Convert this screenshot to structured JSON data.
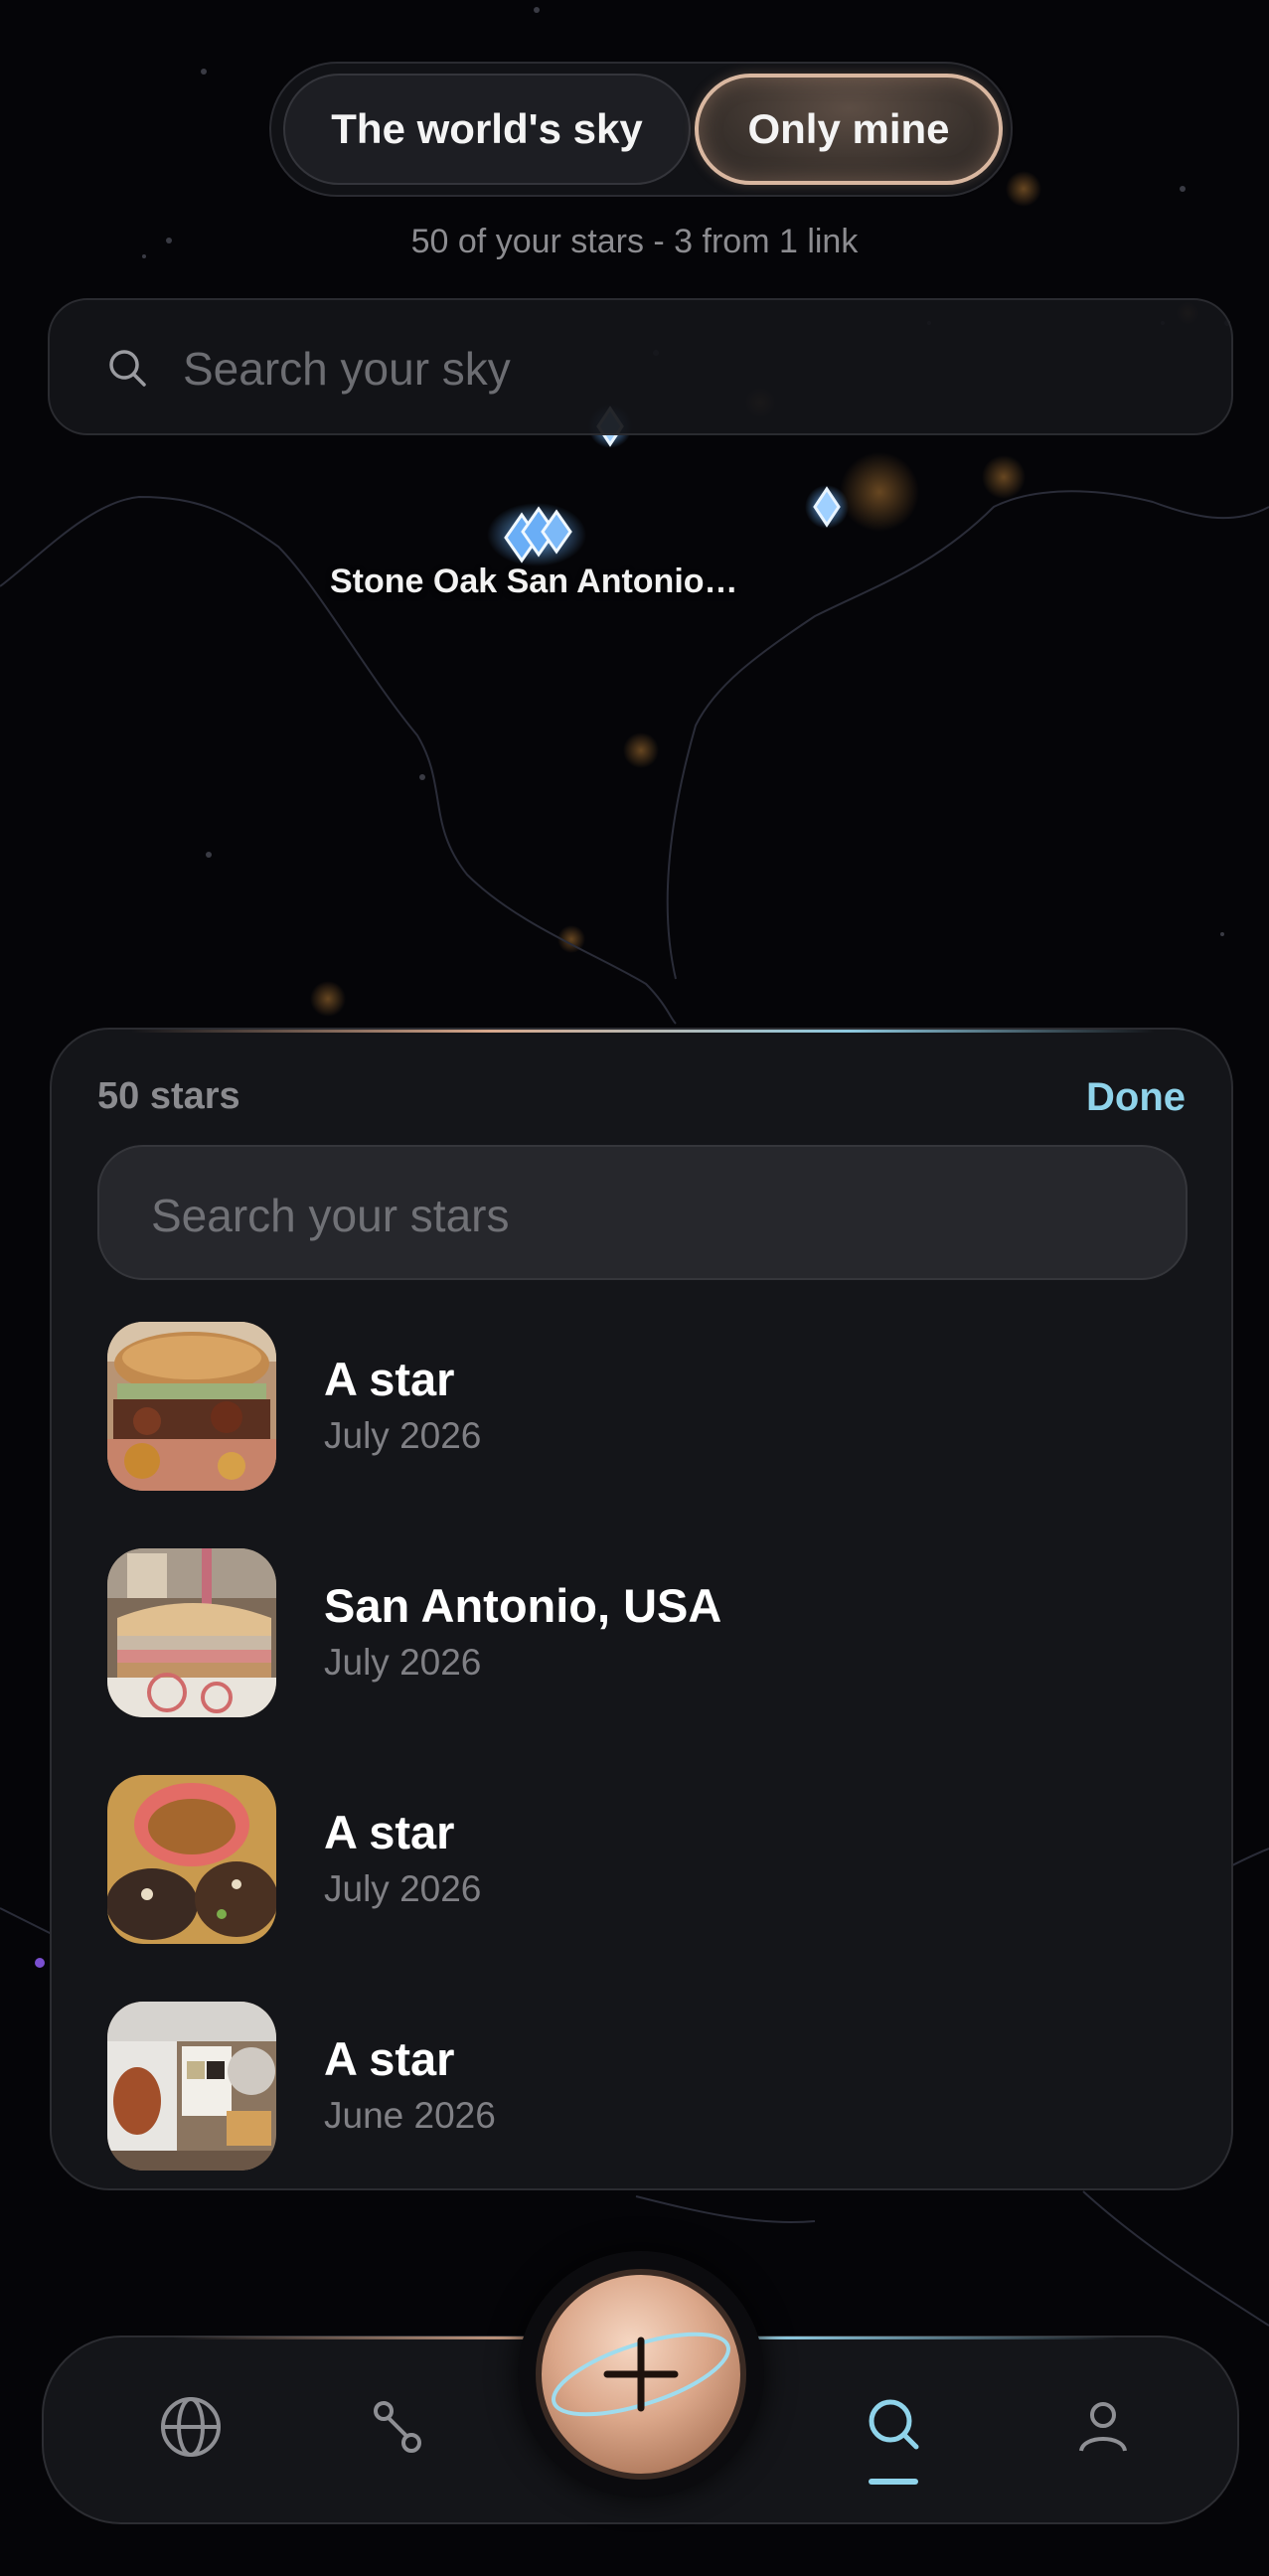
{
  "toggle": {
    "world_label": "The world's sky",
    "mine_label": "Only mine",
    "selected": "Only mine"
  },
  "subtitle": "50 of your stars - 3 from 1 link",
  "sky_search": {
    "placeholder": "Search your sky"
  },
  "map": {
    "cluster_label": "Stone Oak San Antonio…"
  },
  "panel": {
    "count": "50 stars",
    "done_label": "Done",
    "search_placeholder": "Search your stars",
    "items": [
      {
        "title": "A star",
        "date": "July 2026",
        "image": "burger-photo"
      },
      {
        "title": "San Antonio, USA",
        "date": "July 2026",
        "image": "sandwich-photo"
      },
      {
        "title": "A star",
        "date": "July 2026",
        "image": "tacos-photo"
      },
      {
        "title": "A star",
        "date": "June 2026",
        "image": "plate-photo"
      }
    ]
  },
  "nav": {
    "items": [
      "globe-icon",
      "route-icon",
      "search-icon",
      "profile-icon"
    ],
    "active": "search-icon",
    "fab_icon": "plus-icon"
  },
  "colors": {
    "accent": "#8fd3ea",
    "rose": "#d9b7a0",
    "background": "#050508",
    "star": "#5aa8f0"
  }
}
